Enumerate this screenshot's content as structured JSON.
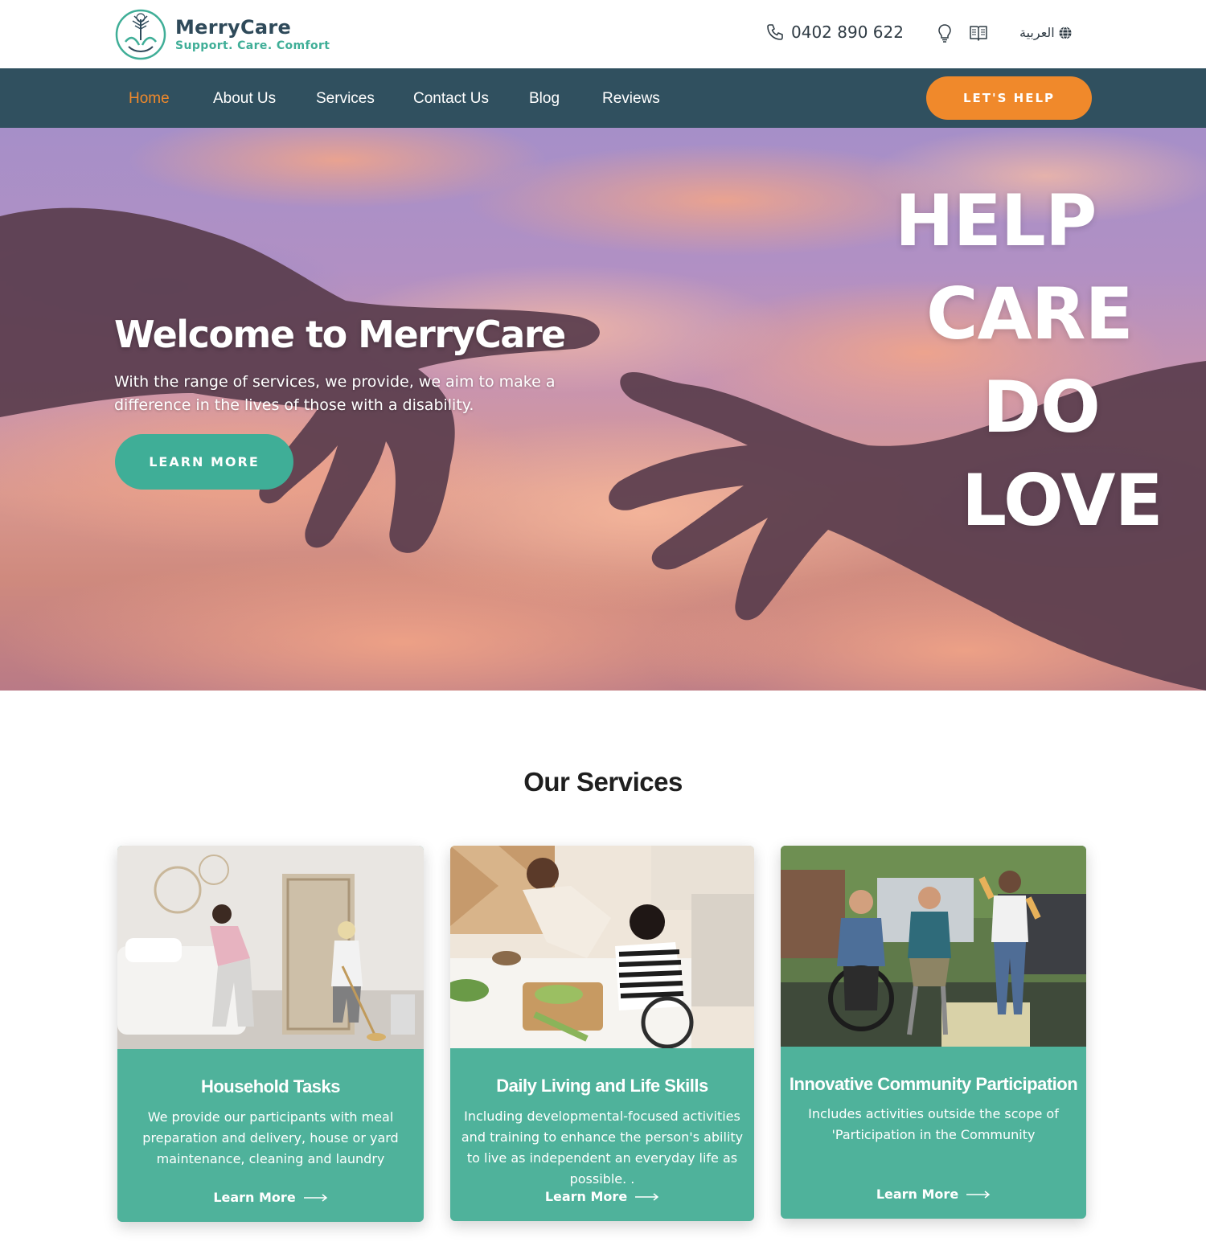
{
  "brand": {
    "name": "MerryCare",
    "tagline": "Support. Care. Comfort"
  },
  "topbar": {
    "phone": "0402 890 622",
    "language_label": "العربية",
    "icons": [
      "phone-icon",
      "lightbulb-icon",
      "book-icon",
      "globe-icon"
    ]
  },
  "nav": {
    "items": [
      {
        "label": "Home",
        "active": true
      },
      {
        "label": "About Us",
        "active": false
      },
      {
        "label": "Services",
        "active": false
      },
      {
        "label": "Contact Us",
        "active": false
      },
      {
        "label": "Blog",
        "active": false
      },
      {
        "label": "Reviews",
        "active": false
      }
    ],
    "cta_label": "LET'S HELP"
  },
  "hero": {
    "title": "Welcome to MerryCare",
    "subtitle": "With the range of services, we provide, we aim to make a difference in the lives of those with a disability.",
    "button_label": "LEARN MORE",
    "words": [
      "HELP",
      "CARE",
      "DO",
      "LOVE"
    ]
  },
  "services": {
    "title": "Our Services",
    "cards": [
      {
        "title": "Household Tasks",
        "description": "We provide our participants with meal preparation and delivery, house or yard maintenance, cleaning and laundry",
        "link_label": "Learn More"
      },
      {
        "title": "Daily Living and Life Skills",
        "description": "Including developmental-focused activities and training to enhance the person's ability to live as independent an everyday life as possible. .",
        "link_label": "Learn More"
      },
      {
        "title": "Innovative Community Participation",
        "description": "Includes activities outside the scope of 'Participation in the Community",
        "link_label": "Learn More"
      }
    ]
  },
  "colors": {
    "nav_bg": "#30505f",
    "accent_orange": "#f0892b",
    "teal": "#3fae97",
    "card_teal": "#4fb29b"
  }
}
